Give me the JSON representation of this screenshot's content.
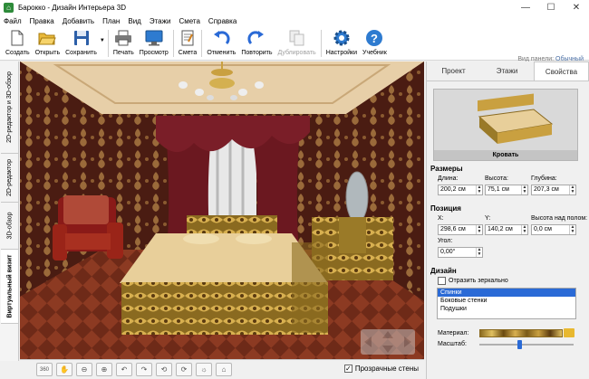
{
  "window": {
    "title": "Барокко - Дизайн Интерьера 3D",
    "controls": [
      "—",
      "☐",
      "✕"
    ]
  },
  "menu": [
    "Файл",
    "Правка",
    "Добавить",
    "План",
    "Вид",
    "Этажи",
    "Смета",
    "Справка"
  ],
  "toolbar": {
    "create": "Создать",
    "open": "Открыть",
    "save": "Сохранить",
    "print": "Печать",
    "preview": "Просмотр",
    "estimate": "Смета",
    "undo": "Отменить",
    "redo": "Повторить",
    "duplicate": "Дублировать",
    "settings": "Настройки",
    "tutorial": "Учебник",
    "panel_view_label": "Вид панели:",
    "panel_view_value": "Обычный"
  },
  "left_tabs": [
    "2D-редактор и 3D-обзор",
    "2D-редактор",
    "3D-обзор",
    "Виртуальный визит"
  ],
  "bottom_bar": {
    "transparent_walls": "Прозрачные стены",
    "transparent_walls_checked": true,
    "btn_360": "360"
  },
  "right_panel": {
    "tabs": [
      "Проект",
      "Этажи",
      "Свойства"
    ],
    "active_tab": "Свойства",
    "object_name": "Кровать",
    "sizes": {
      "header": "Размеры",
      "length_label": "Длина:",
      "length_value": "200,2 см",
      "height_label": "Высота:",
      "height_value": "75,1 см",
      "depth_label": "Глубина:",
      "depth_value": "207,3 см"
    },
    "position": {
      "header": "Позиция",
      "x_label": "X:",
      "x_value": "298,6 см",
      "y_label": "Y:",
      "y_value": "140,2 см",
      "floor_height_label": "Высота над полом:",
      "floor_height_value": "0,0 см",
      "angle_label": "Угол:",
      "angle_value": "0,00°"
    },
    "design": {
      "header": "Дизайн",
      "mirror_label": "Отразить зеркально",
      "mirror_checked": false,
      "parts": [
        "Спинки",
        "Боковые стенки",
        "Подушки"
      ],
      "selected_part": "Спинки",
      "material_label": "Материал:",
      "scale_label": "Масштаб:",
      "scale_fraction": 0.4
    }
  },
  "colors": {
    "accent": "#2a6ad6",
    "wallpaper": "#5a2418",
    "ceiling": "#e7cfa8",
    "bedspread": "#e8cf9a",
    "curtain": "#6b1820",
    "floor": "#7a2e1c"
  }
}
